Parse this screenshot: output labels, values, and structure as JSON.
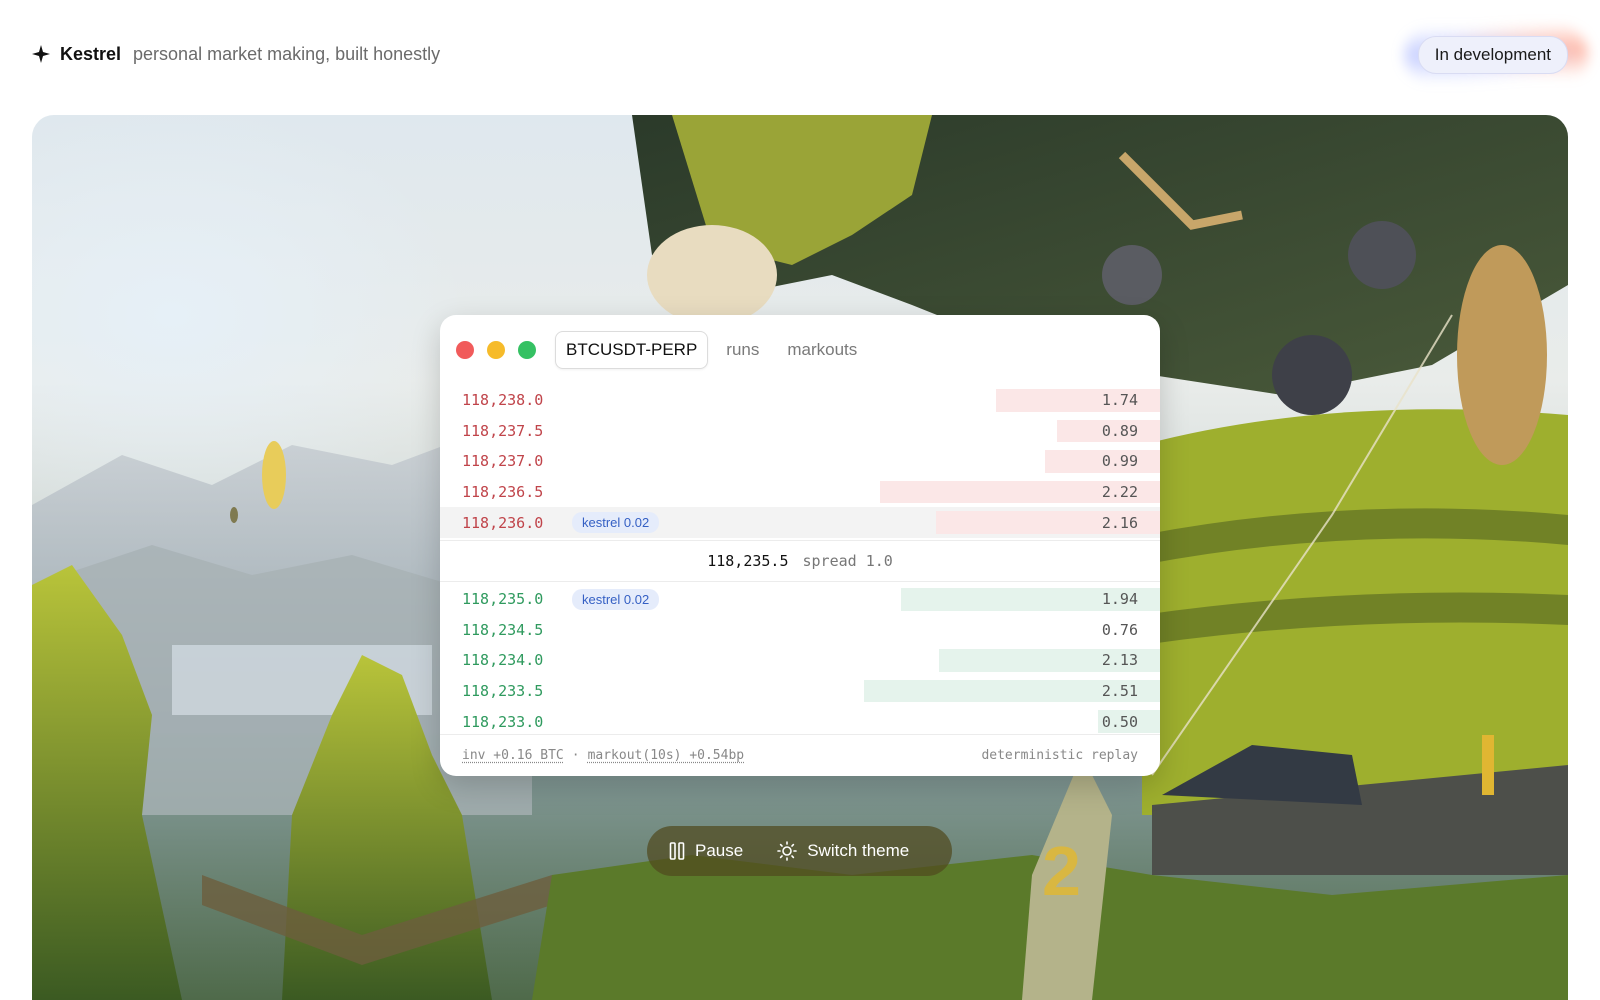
{
  "header": {
    "brand": "Kestrel",
    "tagline": "personal market making, built honestly",
    "status": "In development",
    "logo_icon": "sparkle-icon"
  },
  "panel": {
    "tabs": [
      {
        "label": "BTCUSDT-PERP",
        "active": true
      },
      {
        "label": "runs",
        "active": false
      },
      {
        "label": "markouts",
        "active": false
      }
    ],
    "asks": [
      {
        "price": "118,238.0",
        "size": "1.74",
        "tag": ""
      },
      {
        "price": "118,237.5",
        "size": "0.89",
        "tag": ""
      },
      {
        "price": "118,237.0",
        "size": "0.99",
        "tag": ""
      },
      {
        "price": "118,236.5",
        "size": "2.22",
        "tag": ""
      },
      {
        "price": "118,236.0",
        "size": "2.16",
        "tag": "kestrel 0.02"
      }
    ],
    "mid": {
      "price": "118,235.5",
      "spread": "spread 1.0"
    },
    "bids": [
      {
        "price": "118,235.0",
        "size": "1.94",
        "tag": "kestrel 0.02"
      },
      {
        "price": "118,234.5",
        "size": "0.76",
        "tag": ""
      },
      {
        "price": "118,234.0",
        "size": "2.13",
        "tag": ""
      },
      {
        "price": "118,233.5",
        "size": "2.51",
        "tag": ""
      },
      {
        "price": "118,233.0",
        "size": "0.50",
        "tag": ""
      }
    ],
    "footer": {
      "inventory": "inv +0.16 BTC",
      "separator": "·",
      "markout": "markout(10s) +0.54bp",
      "mode": "deterministic replay"
    }
  },
  "controls": {
    "pause_label": "Pause",
    "pause_icon": "pause-icon",
    "theme_label": "Switch theme",
    "theme_icon": "sun-icon"
  },
  "colors": {
    "ask": "#c0444a",
    "bid": "#2f9a5e",
    "tag_text": "#3560c4"
  }
}
